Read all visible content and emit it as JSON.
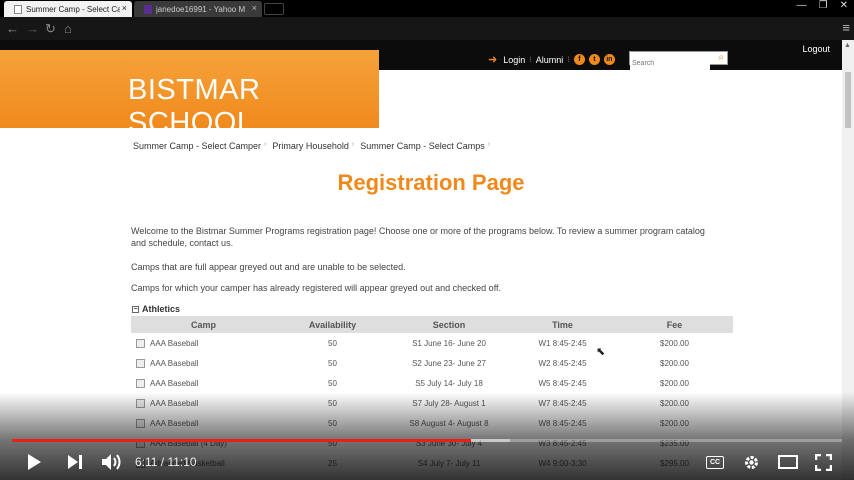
{
  "browser": {
    "tabs": [
      {
        "label": "Summer Camp - Select Ca",
        "close": "×"
      },
      {
        "label": "janedoe16991 - Yahoo M",
        "close": "×"
      }
    ],
    "window_controls": {
      "minimize": "—",
      "restore": "❐",
      "close": "✕"
    },
    "nav": {
      "back": "←",
      "forward": "→",
      "reload": "↻",
      "home": "⌂"
    }
  },
  "site": {
    "logout": "Logout",
    "login": "Login",
    "alumni": "Alumni",
    "search_placeholder": "Search",
    "brand": "BISTMAR SCHOOL",
    "accent_color": "#f0891c"
  },
  "breadcrumb": [
    "Summer Camp - Select Camper",
    "Primary Household",
    "Summer Camp - Select Camps"
  ],
  "page": {
    "title": "Registration Page",
    "intro": "Welcome to the Bistmar Summer Programs registration page! Choose one or more of the programs below. To review a summer program catalog and schedule, contact us.",
    "note_full": "Camps that are full appear greyed out and are unable to be selected.",
    "note_registered": "Camps for which your camper has already registered will appear greyed out and checked off."
  },
  "section": {
    "title": "Athletics",
    "toggle": "−"
  },
  "table": {
    "headers": [
      "Camp",
      "Availability",
      "Section",
      "Time",
      "Fee"
    ],
    "rows": [
      {
        "camp": "AAA Baseball",
        "availability": "50",
        "section": "S1 June 16- June 20",
        "time": "W1 8:45-2:45",
        "fee": "$200.00"
      },
      {
        "camp": "AAA Baseball",
        "availability": "50",
        "section": "S2 June 23- June 27",
        "time": "W2 8:45-2:45",
        "fee": "$200.00"
      },
      {
        "camp": "AAA Baseball",
        "availability": "50",
        "section": "S5 July 14- July 18",
        "time": "W5 8:45-2:45",
        "fee": "$200.00"
      },
      {
        "camp": "AAA Baseball",
        "availability": "50",
        "section": "S7 July 28- August 1",
        "time": "W7 8:45-2:45",
        "fee": "$200.00"
      },
      {
        "camp": "AAA Baseball",
        "availability": "50",
        "section": "S8 August 4- August 8",
        "time": "W8 8:45-2:45",
        "fee": "$200.00"
      },
      {
        "camp": "AAA Baseball (4 Day)",
        "availability": "50",
        "section": "S3 June 30- July 4",
        "time": "W3 8:45-2:45",
        "fee": "$235.00"
      },
      {
        "camp": "Advanced Basketball",
        "availability": "25",
        "section": "S4 July 7- July 11",
        "time": "W4 9:00-3:30",
        "fee": "$295.00"
      }
    ]
  },
  "player": {
    "current_time": "6:11",
    "duration": "11:10",
    "time_display": "6:11 / 11:10",
    "played_fraction": 0.553,
    "buffered_fraction": 0.6,
    "cc_label": "CC"
  }
}
